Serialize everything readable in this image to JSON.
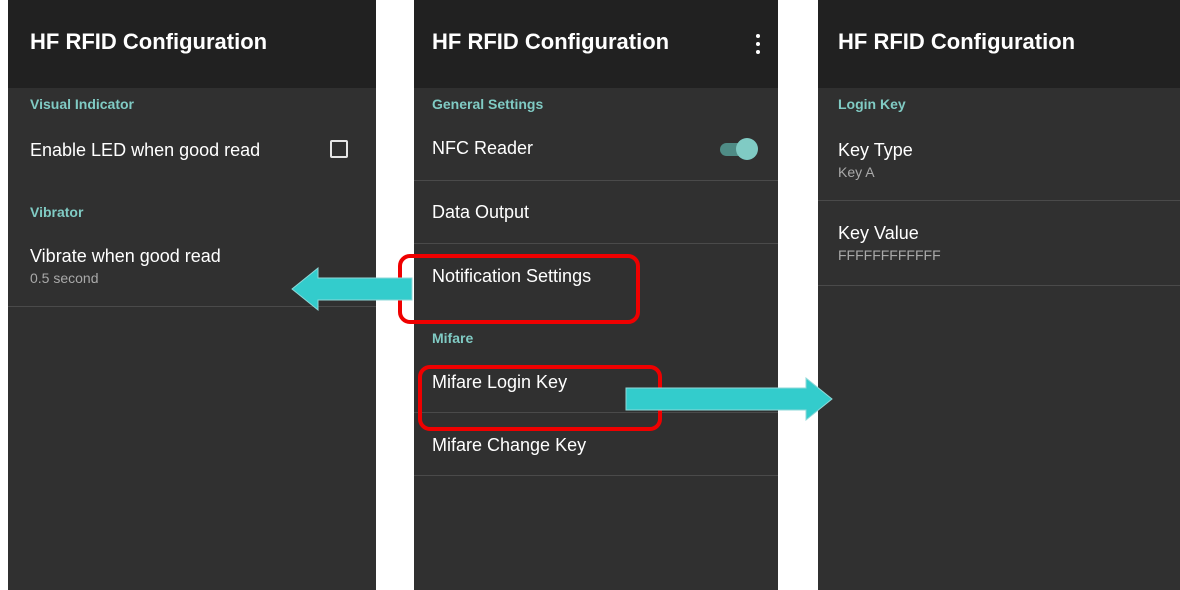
{
  "screens": {
    "left": {
      "title": "HF RFID Configuration",
      "sections": [
        {
          "header": "Visual Indicator",
          "items": [
            {
              "title": "Enable LED when good read",
              "checked": false
            }
          ]
        },
        {
          "header": "Vibrator",
          "items": [
            {
              "title": "Vibrate when good read",
              "summary": "0.5 second"
            }
          ]
        }
      ]
    },
    "middle": {
      "title": "HF RFID Configuration",
      "menu_icon": "overflow-menu-icon",
      "sections": [
        {
          "header": "General Settings",
          "items": [
            {
              "title": "NFC Reader",
              "toggle_on": true
            },
            {
              "title": "Data Output"
            },
            {
              "title": "Notification Settings"
            }
          ]
        },
        {
          "header": "Mifare",
          "items": [
            {
              "title": "Mifare Login Key"
            },
            {
              "title": "Mifare Change Key"
            }
          ]
        }
      ]
    },
    "right": {
      "title": "HF RFID Configuration",
      "sections": [
        {
          "header": "Login Key",
          "items": [
            {
              "title": "Key Type",
              "summary": "Key A"
            },
            {
              "title": "Key Value",
              "summary": "FFFFFFFFFFFF"
            }
          ]
        }
      ]
    }
  },
  "colors": {
    "accent": "#80cbc4",
    "highlight": "#ef0000",
    "arrow": "#33cccc",
    "screen_bg": "#303030",
    "appbar_bg": "#212121"
  }
}
